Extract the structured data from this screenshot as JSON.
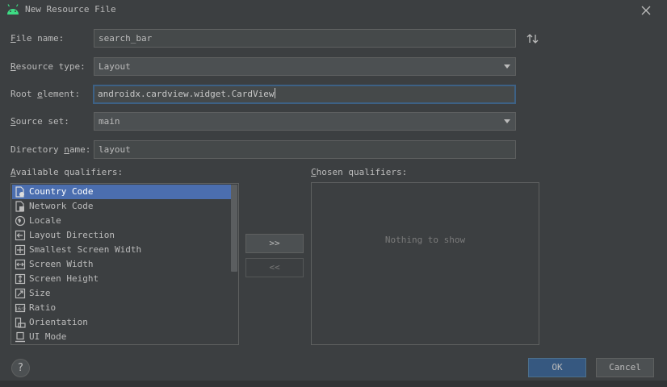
{
  "window": {
    "title": "New Resource File"
  },
  "form": {
    "file_name": {
      "label_pre": "",
      "label_mnemonic": "F",
      "label_post": "ile name:",
      "value": "search_bar"
    },
    "resource_type": {
      "label_pre": "",
      "label_mnemonic": "R",
      "label_post": "esource type:",
      "value": "Layout"
    },
    "root_element": {
      "label_pre": "Root ",
      "label_mnemonic": "e",
      "label_post": "lement:",
      "value": "androidx.cardview.widget.CardView"
    },
    "source_set": {
      "label_pre": "",
      "label_mnemonic": "S",
      "label_post": "ource set:",
      "value": "main"
    },
    "directory_name": {
      "label_pre": "Directory ",
      "label_mnemonic": "n",
      "label_post": "ame:",
      "value": "layout"
    }
  },
  "available": {
    "label_pre": "",
    "label_mnemonic": "A",
    "label_post": "vailable qualifiers:",
    "items": [
      {
        "label": "Country Code",
        "icon": "country-code-icon",
        "selected": true
      },
      {
        "label": "Network Code",
        "icon": "network-code-icon",
        "selected": false
      },
      {
        "label": "Locale",
        "icon": "globe-icon",
        "selected": false
      },
      {
        "label": "Layout Direction",
        "icon": "layout-direction-icon",
        "selected": false
      },
      {
        "label": "Smallest Screen Width",
        "icon": "smallest-width-icon",
        "selected": false
      },
      {
        "label": "Screen Width",
        "icon": "screen-width-icon",
        "selected": false
      },
      {
        "label": "Screen Height",
        "icon": "screen-height-icon",
        "selected": false
      },
      {
        "label": "Size",
        "icon": "size-icon",
        "selected": false
      },
      {
        "label": "Ratio",
        "icon": "ratio-icon",
        "selected": false
      },
      {
        "label": "Orientation",
        "icon": "orientation-icon",
        "selected": false
      },
      {
        "label": "UI Mode",
        "icon": "ui-mode-icon",
        "selected": false
      }
    ]
  },
  "chosen": {
    "label_pre": "",
    "label_mnemonic": "C",
    "label_post": "hosen qualifiers:",
    "empty_text": "Nothing to show"
  },
  "buttons": {
    "add": ">>",
    "remove": "<<",
    "help": "?",
    "ok": "OK",
    "cancel": "Cancel"
  },
  "colors": {
    "background": "#3c3f41",
    "selection": "#4b6eaf",
    "focus_border": "#3d6185",
    "ok_button": "#365880",
    "android_green": "#3ddc84"
  }
}
